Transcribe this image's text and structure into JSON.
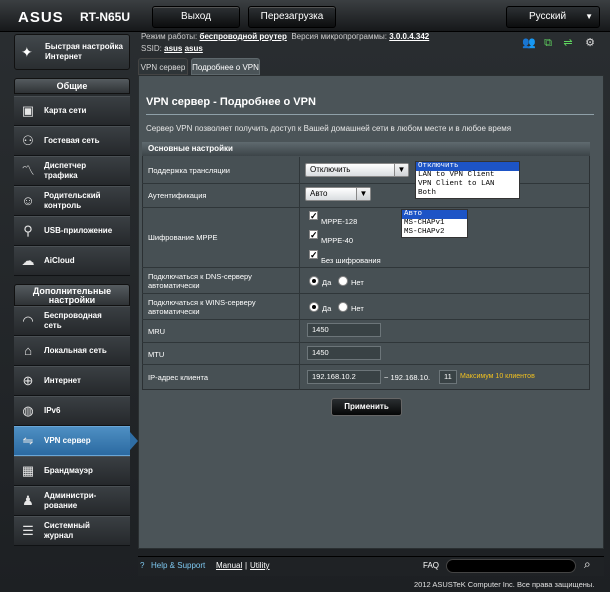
{
  "header": {
    "brand": "ASUS",
    "model": "RT-N65U",
    "logout": "Выход",
    "reboot": "Перезагрузка",
    "language": "Русский",
    "mode_label": "Режим работы:",
    "mode_value": "беспроводной роутер",
    "fw_label": "Версия микропрограммы:",
    "fw_value": "3.0.0.4.342",
    "ssid_label": "SSID:",
    "ssid_1": "asus",
    "ssid_2": "asus"
  },
  "sidebar": {
    "qis": [
      "Быстрая настройка",
      "Интернет"
    ],
    "general": "Общие",
    "advanced": [
      "Дополнительные",
      "настройки"
    ],
    "general_items": [
      [
        "Карта сети",
        ""
      ],
      [
        "Гостевая сеть",
        ""
      ],
      [
        "Диспетчер",
        "трафика"
      ],
      [
        "Родительский",
        "контроль"
      ],
      [
        "USB-приложение",
        ""
      ],
      [
        "AiCloud",
        ""
      ]
    ],
    "advanced_items": [
      [
        "Беспроводная",
        "сеть"
      ],
      [
        "Локальная сеть",
        ""
      ],
      [
        "Интернет",
        ""
      ],
      [
        "IPv6",
        ""
      ],
      [
        "VPN сервер",
        ""
      ],
      [
        "Брандмауэр",
        ""
      ],
      [
        "Админист­ри-",
        "рование"
      ],
      [
        "Системный",
        "журнал"
      ]
    ]
  },
  "tabs": [
    "VPN сервер",
    "Подробнее о VPN"
  ],
  "page": {
    "title": "VPN сервер - Подробнее о VPN",
    "description": "Сервер VPN позволяет получить доступ к Вашей домашней сети в любом месте и в любое время",
    "section": "Основные настройки",
    "rows": {
      "passthrough": "Поддержка трансляции",
      "auth": "Аутентификация",
      "mppe": "Шифрование MPPE",
      "dns": [
        "Подключаться к DNS-серверу",
        "автоматически"
      ],
      "wins": [
        "Подключаться к WINS-серверу",
        "автоматически"
      ],
      "mru": "MRU",
      "mtu": "MTU",
      "client_ip": "IP-адрес клиента"
    },
    "passthrough_value": "Отключить",
    "passthrough_options": [
      "Отключить",
      "LAN to VPN Client",
      "VPN Client to LAN",
      "Both"
    ],
    "auth_value": "Авто",
    "auth_options": [
      "Авто",
      "MS-CHAPv1",
      "MS-CHAPv2"
    ],
    "mppe_options": [
      "MPPE-128",
      "MPPE-40",
      "Без шифрования"
    ],
    "yes": "Да",
    "no": "Нет",
    "mru_value": "1450",
    "mtu_value": "1450",
    "ip_start": "192.168.10.2",
    "ip_sep": "~ 192.168.10.",
    "ip_end": "11",
    "ip_note": "Максимум 10 клиентов",
    "apply": "Применить"
  },
  "footer": {
    "help": "Help & Support",
    "manual": "Manual",
    "utility": "Utility",
    "sep": "|",
    "faq": "FAQ",
    "copyright": "2012 ASUSTeK Computer Inc. Все права защищены."
  },
  "colors": {
    "accent": "#2b6aa1",
    "note": "#f0c020"
  }
}
